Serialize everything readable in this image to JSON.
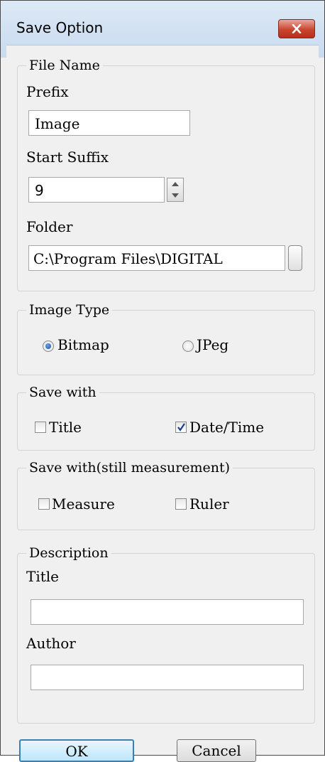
{
  "window": {
    "title": "Save Option",
    "close_icon": "close-x-icon",
    "accent": "#c9452f"
  },
  "file_name": {
    "legend": "File Name",
    "prefix_label": "Prefix",
    "prefix_value": "Image",
    "suffix_label": "Start Suffix",
    "suffix_value": "9",
    "folder_label": "Folder",
    "folder_value": "C:\\Program Files\\DIGITAL"
  },
  "image_type": {
    "legend": "Image Type",
    "options": [
      {
        "label": "Bitmap",
        "selected": true
      },
      {
        "label": "JPeg",
        "selected": false
      }
    ]
  },
  "save_with": {
    "legend": "Save with",
    "options": [
      {
        "label": "Title",
        "checked": false
      },
      {
        "label": "Date/Time",
        "checked": true
      }
    ]
  },
  "save_with_measure": {
    "legend": "Save with(still measurement)",
    "options": [
      {
        "label": "Measure",
        "checked": false
      },
      {
        "label": "Ruler",
        "checked": false
      }
    ]
  },
  "description": {
    "legend": "Description",
    "title_label": "Title",
    "title_value": "",
    "author_label": "Author",
    "author_value": ""
  },
  "buttons": {
    "ok": "OK",
    "cancel": "Cancel"
  }
}
